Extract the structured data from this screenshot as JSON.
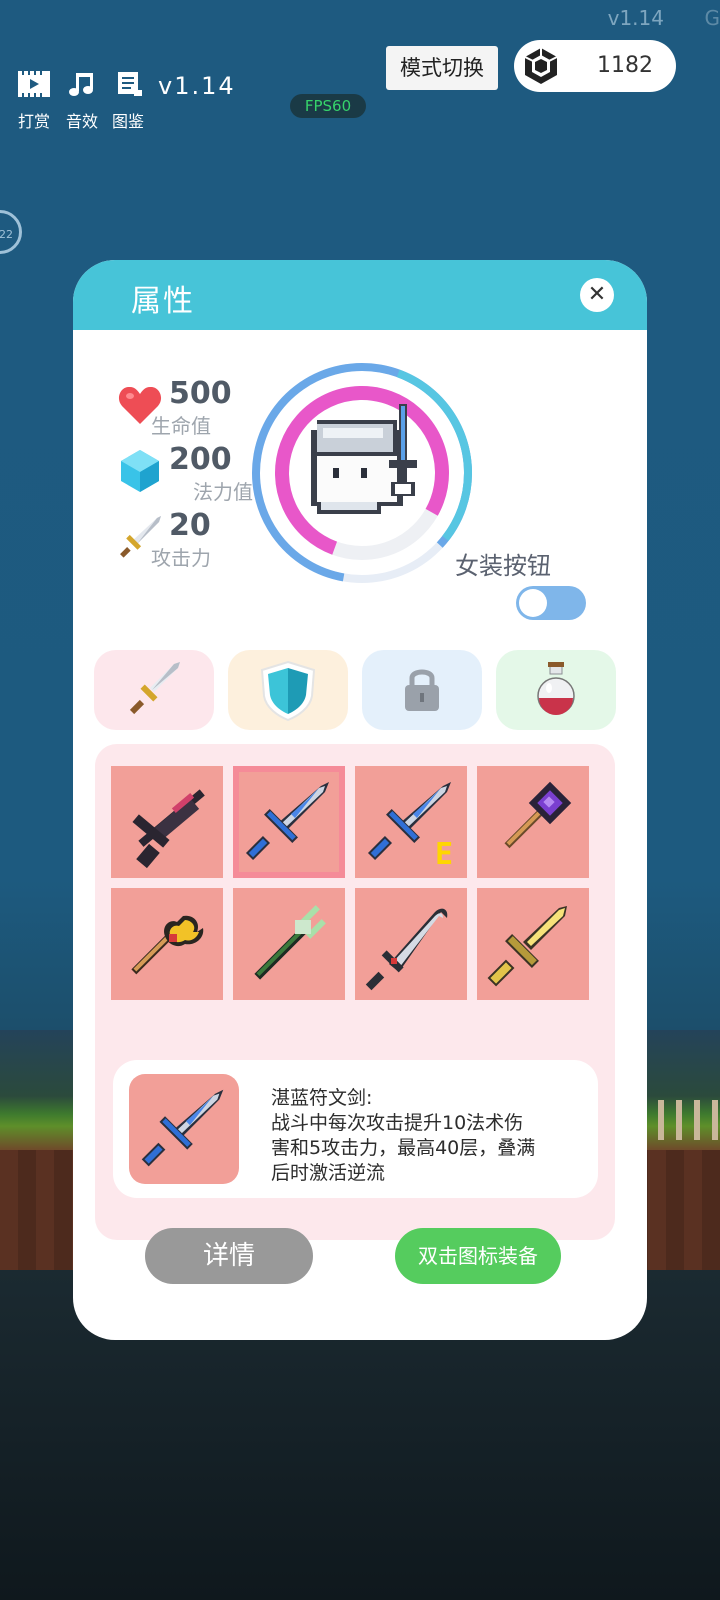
{
  "header": {
    "corner_version": "v1.14",
    "corner_version_suffix": "G",
    "buttons": [
      {
        "label": "打赏",
        "icon": "film-icon"
      },
      {
        "label": "音效",
        "icon": "music-note-icon"
      },
      {
        "label": "图鉴",
        "icon": "scroll-icon"
      }
    ],
    "version": "v1.14",
    "fps": "FPS60",
    "mode_switch": "模式切换",
    "gems": "1182"
  },
  "side_badge": "22",
  "panel": {
    "title": "属性",
    "stats": [
      {
        "value": "500",
        "label": "生命值",
        "icon": "heart-icon"
      },
      {
        "value": "200",
        "label": "法力值",
        "icon": "crystal-icon"
      },
      {
        "value": "20",
        "label": "攻击力",
        "icon": "sword-icon"
      }
    ],
    "toggle_label": "女装按钮",
    "toggle_on": true,
    "tabs": [
      {
        "icon": "sword-icon",
        "color": "#fde7ec"
      },
      {
        "icon": "shield-icon",
        "color": "#fdf0dd"
      },
      {
        "icon": "lock-icon",
        "color": "#e4f0fb"
      },
      {
        "icon": "potion-icon",
        "color": "#e4f8e8"
      }
    ],
    "items": [
      {
        "name": "dark-gun-icon",
        "badge": ""
      },
      {
        "name": "blue-rune-sword-icon",
        "badge": ""
      },
      {
        "name": "blue-rune-sword-icon",
        "badge": "E"
      },
      {
        "name": "purple-staff-icon",
        "badge": ""
      },
      {
        "name": "golden-trident-icon",
        "badge": ""
      },
      {
        "name": "green-staff-icon",
        "badge": ""
      },
      {
        "name": "curved-blade-icon",
        "badge": ""
      },
      {
        "name": "golden-sword-icon",
        "badge": ""
      }
    ],
    "description": {
      "title": "湛蓝符文剑:",
      "line1": "战斗中每次攻击提升10法术伤",
      "line2": "害和5攻击力，最高40层，叠满",
      "line3": "后时激活逆流"
    },
    "detail_button": "详情",
    "equip_button": "双击图标装备"
  },
  "colors": {
    "header_teal": "#47c4d8",
    "slot_red": "#f29f98",
    "equip_green": "#55cc5e",
    "detail_gray": "#999999"
  }
}
